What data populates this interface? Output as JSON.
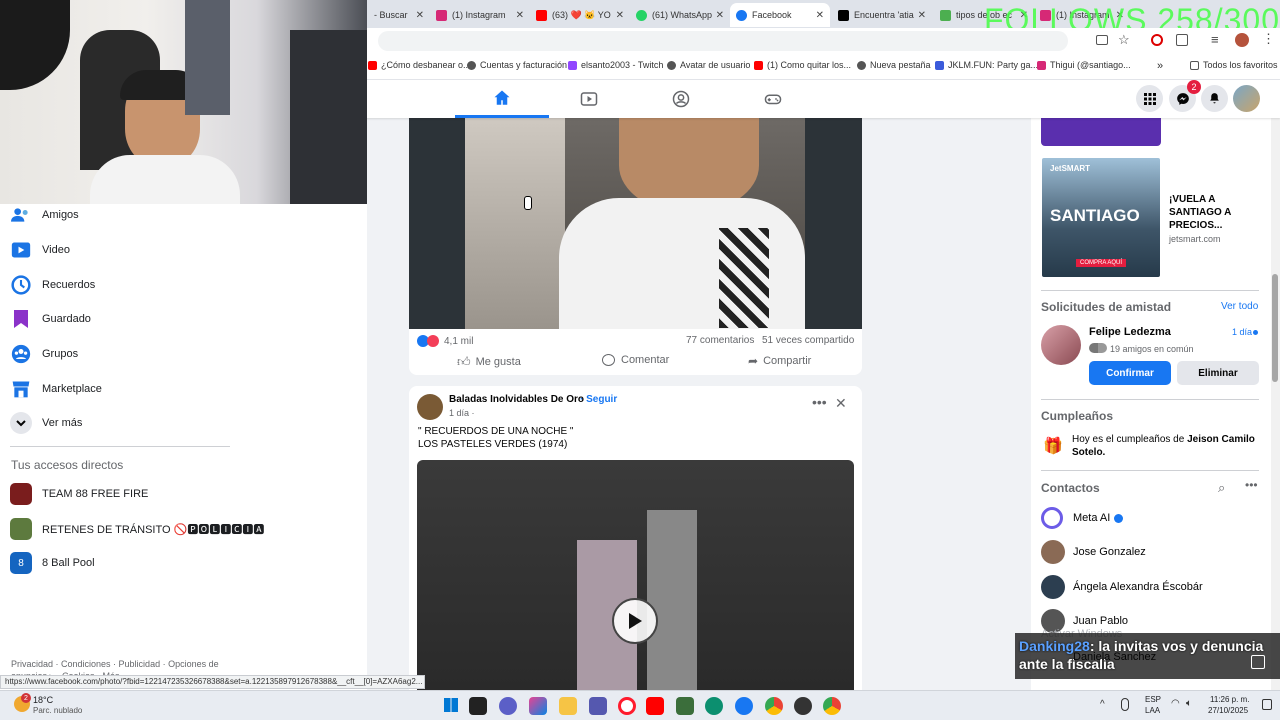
{
  "overlay": {
    "follows": "FOLLOWS 258/300"
  },
  "tabs": [
    {
      "label": "- Buscar",
      "color": "#e53935"
    },
    {
      "label": "(1) Instagram",
      "color": "#d62976"
    },
    {
      "label": "(63) ❤️ 🐱 YO",
      "color": "#ff0000"
    },
    {
      "label": "(61) WhatsApp",
      "color": "#25d366"
    },
    {
      "label": "Facebook",
      "color": "#1877f2"
    },
    {
      "label": "Encuentra 'atia",
      "color": "#000000"
    },
    {
      "label": "tipos de ob ec",
      "color": "#4caf50"
    },
    {
      "label": "(1) Instagram",
      "color": "#d62976"
    }
  ],
  "bookmarks": [
    {
      "label": "¿Cómo desbanear o...",
      "color": "#ff0000"
    },
    {
      "label": "Cuentas y facturación",
      "color": "#555555"
    },
    {
      "label": "elsanto2003 - Twitch",
      "color": "#9146ff"
    },
    {
      "label": "Avatar de usuario",
      "color": "#555555"
    },
    {
      "label": "(1) Como quitar los...",
      "color": "#ff0000"
    },
    {
      "label": "Nueva pestaña",
      "color": "#555555"
    },
    {
      "label": "JKLM.FUN: Party ga...",
      "color": "#3b5bdb"
    },
    {
      "label": "Thigui (@santiago...",
      "color": "#d62976"
    },
    {
      "label": "Todos los favoritos",
      "color": "#555555"
    }
  ],
  "header": {
    "messenger_badge": "2"
  },
  "sidebar": {
    "items": [
      {
        "label": "Amigos",
        "icon": "friends-icon"
      },
      {
        "label": "Video",
        "icon": "video-icon"
      },
      {
        "label": "Recuerdos",
        "icon": "memories-icon"
      },
      {
        "label": "Guardado",
        "icon": "saved-icon"
      },
      {
        "label": "Grupos",
        "icon": "groups-icon"
      },
      {
        "label": "Marketplace",
        "icon": "marketplace-icon"
      },
      {
        "label": "Ver más",
        "icon": "chevron-down-icon"
      }
    ],
    "shortcuts_title": "Tus accesos directos",
    "shortcuts": [
      {
        "label": "TEAM 88 FREE FIRE"
      },
      {
        "label": "RETENES DE TRÁNSITO 🚫🅿🅾🅻🅸🅲🅸🅰"
      },
      {
        "label": "8 Ball Pool"
      }
    ],
    "footer": "Privacidad · Condiciones · Publicidad · Opciones de anuncios ▸ · Cookies · Más ·"
  },
  "post1": {
    "reactions": "4,1 mil",
    "comments": "77 comentarios",
    "shares": "51 veces compartido",
    "like": "Me gusta",
    "comment": "Comentar",
    "share": "Compartir"
  },
  "post2": {
    "page": "Baladas Inolvidables De Oro",
    "follow": "· Seguir",
    "time": "1 día ·",
    "text1": "\" RECUERDOS DE UNA NOCHE \"",
    "text2": "LOS PASTELES VERDES (1974)"
  },
  "right": {
    "ad": {
      "title": "¡VUELA A SANTIAGO A PRECIOS...",
      "domain": "jetsmart.com",
      "brand": "JetSMART",
      "img_text": "SANTIAGO",
      "cta": "COMPRA AQUÍ"
    },
    "friend_requests_title": "Solicitudes de amistad",
    "see_all": "Ver todo",
    "request": {
      "name": "Felipe Ledezma",
      "time": "1 día",
      "mutual": "19 amigos en común",
      "confirm": "Confirmar",
      "delete": "Eliminar"
    },
    "birthdays_title": "Cumpleaños",
    "birthday_prefix": "Hoy es el cumpleaños de ",
    "birthday_name": "Jeison Camilo Sotelo.",
    "contacts_title": "Contactos",
    "contacts": [
      {
        "name": "Meta AI"
      },
      {
        "name": "Jose Gonzalez"
      },
      {
        "name": "Ángela Alexandra Éscobár"
      },
      {
        "name": "Juan Pablo"
      },
      {
        "name": "Daniela Sanchez"
      }
    ]
  },
  "activation_watermark": "Activar Windows",
  "chat_overlay": {
    "user": "Danking28",
    "message": ": la invitas vos y denuncia ante la fiscalia"
  },
  "status_url": "https://www.facebook.com/photo/?fbid=122147235326678388&set=a.122135897912678388&__cft__[0]=AZXA6ag2...",
  "taskbar": {
    "temp": "18°C",
    "weather": "Parc. nublado",
    "weather_badge": "2",
    "lang1": "ESP",
    "lang2": "LAA",
    "time": "11:26 p. m.",
    "date": "27/10/2025"
  }
}
